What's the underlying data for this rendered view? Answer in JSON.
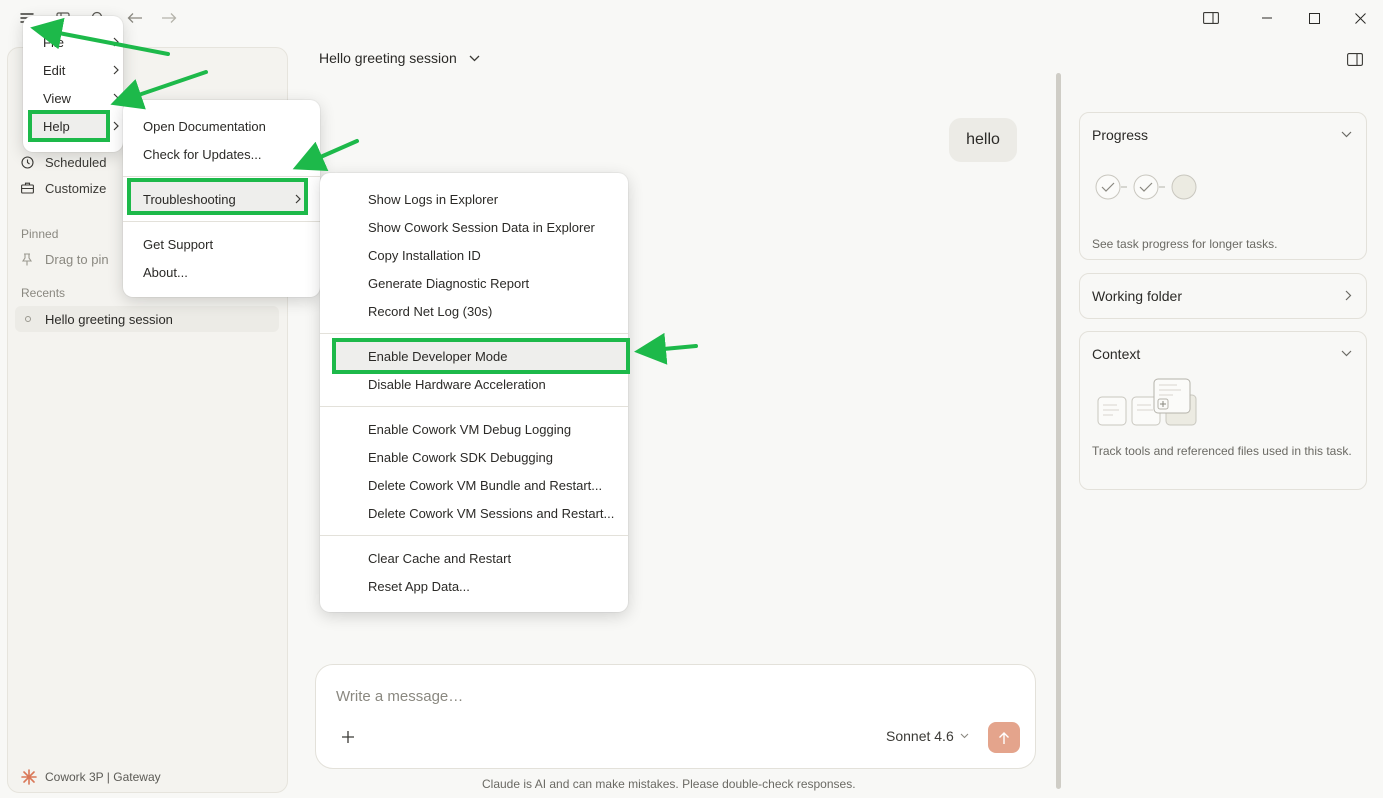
{
  "titlebar": {
    "icons": [
      "menu-icon",
      "sidebar-toggle-icon",
      "search-icon",
      "back-arrow-icon",
      "forward-arrow-icon"
    ],
    "window_controls": [
      "panel-icon",
      "minimize-icon",
      "maximize-icon",
      "close-icon"
    ]
  },
  "sidebar": {
    "nav": [
      {
        "label": "Scheduled",
        "icon": "clock-icon"
      },
      {
        "label": "Customize",
        "icon": "briefcase-icon"
      }
    ],
    "pinned_header": "Pinned",
    "pinned_placeholder": "Drag to pin",
    "recents_header": "Recents",
    "recents": [
      {
        "label": "Hello greeting session"
      }
    ],
    "footer": "Cowork 3P | Gateway"
  },
  "main": {
    "session_title": "Hello greeting session",
    "messages": [
      {
        "role": "user",
        "text": "hello"
      }
    ],
    "composer_placeholder": "Write a message…",
    "model": "Sonnet 4.6",
    "disclaimer": "Claude is AI and can make mistakes. Please double-check responses."
  },
  "right_panel": {
    "progress": {
      "title": "Progress",
      "subtitle": "See task progress for longer tasks."
    },
    "working_folder": {
      "title": "Working folder"
    },
    "context": {
      "title": "Context",
      "subtitle": "Track tools and referenced files used in this task."
    }
  },
  "menus": {
    "main": [
      {
        "label": "File"
      },
      {
        "label": "Edit"
      },
      {
        "label": "View"
      },
      {
        "label": "Help",
        "highlighted": true
      }
    ],
    "help": [
      {
        "label": "Open Documentation"
      },
      {
        "label": "Check for Updates..."
      },
      {
        "label": "Troubleshooting",
        "highlighted": true
      },
      {
        "label": "Get Support"
      },
      {
        "label": "About..."
      }
    ],
    "troubleshooting": [
      {
        "label": "Show Logs in Explorer"
      },
      {
        "label": "Show Cowork Session Data in Explorer"
      },
      {
        "label": "Copy Installation ID"
      },
      {
        "label": "Generate Diagnostic Report"
      },
      {
        "label": "Record Net Log (30s)"
      },
      {
        "label": "Enable Developer Mode",
        "highlighted": true
      },
      {
        "label": "Disable Hardware Acceleration"
      },
      {
        "label": "Enable Cowork VM Debug Logging"
      },
      {
        "label": "Enable Cowork SDK Debugging"
      },
      {
        "label": "Delete Cowork VM Bundle and Restart..."
      },
      {
        "label": "Delete Cowork VM Sessions and Restart..."
      },
      {
        "label": "Clear Cache and Restart"
      },
      {
        "label": "Reset App Data..."
      }
    ]
  },
  "colors": {
    "highlight_box": "#1db94a",
    "send_button": "#e4a48c",
    "brand_accent": "#d97757"
  }
}
